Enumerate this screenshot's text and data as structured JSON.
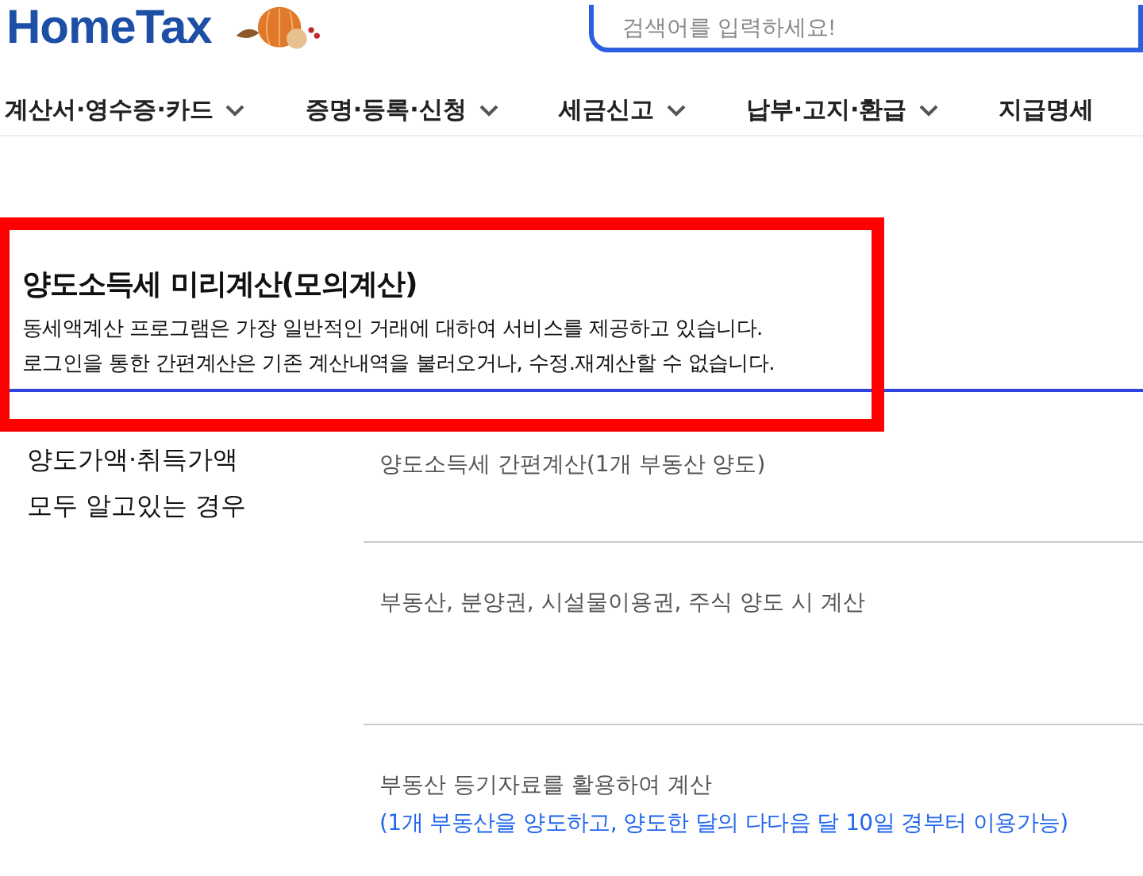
{
  "header": {
    "logo": "HomeTax",
    "search": {
      "placeholder": "검색어를 입력하세요!"
    }
  },
  "nav": [
    {
      "label": "계산서·영수증·카드",
      "dropdown": true
    },
    {
      "label": "증명·등록·신청",
      "dropdown": true
    },
    {
      "label": "세금신고",
      "dropdown": true
    },
    {
      "label": "납부·고지·환급",
      "dropdown": true
    },
    {
      "label": "지급명세",
      "dropdown": false
    }
  ],
  "intro": {
    "title": "양도소득세 미리계산(모의계산)",
    "lines": [
      "동세액계산 프로그램은 가장 일반적인 거래에 대하여 서비스를 제공하고 있습니다.",
      "로그인을 통한 간편계산은 기존 계산내역을 불러오거나, 수정.재계산할 수 없습니다."
    ],
    "highlighted": true
  },
  "section": {
    "heading_lines": [
      "양도가액·취득가액",
      "모두 알고있는 경우"
    ],
    "options": [
      {
        "label": "양도소득세 간편계산(1개 부동산 양도)"
      },
      {
        "label": "부동산, 분양권, 시설물이용권, 주식 양도 시 계산"
      },
      {
        "label": "부동산 등기자료를 활용하여 계산",
        "note": "(1개 부동산을 양도하고, 양도한 달의 다다음 달 10일 경부터 이용가능)"
      }
    ]
  }
}
